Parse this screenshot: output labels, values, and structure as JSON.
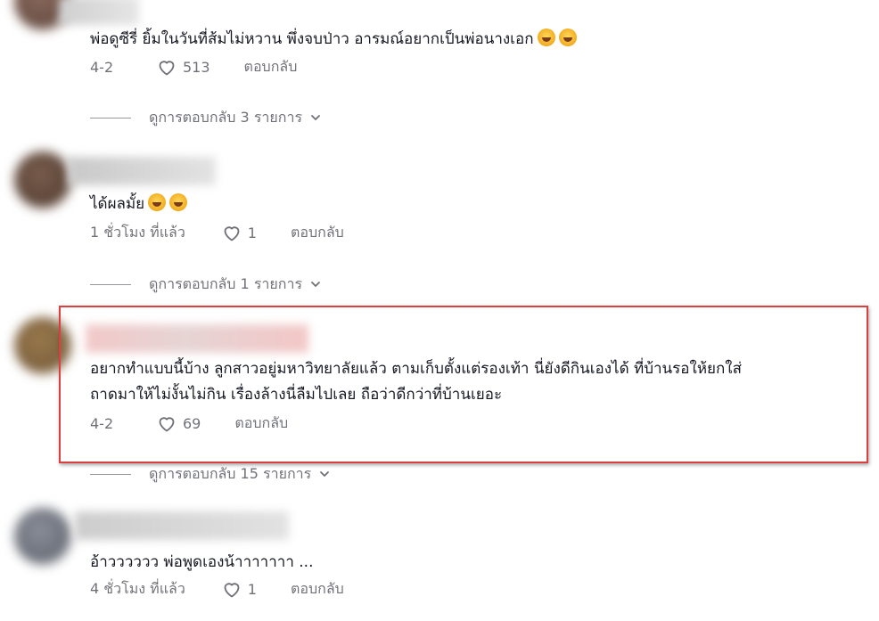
{
  "comments": [
    {
      "text": "พ่อดูซีรี่ ยิ้มในวันที่ส้มไม่หวาน พึ่งจบป่าว อารมณ์อยากเป็นพ่อนางเอก",
      "emoji": [
        "rolling-on-floor-laughing",
        "rolling-on-floor-laughing"
      ],
      "date": "4-2",
      "likes": "513",
      "reply_label": "ตอบกลับ",
      "view_replies": "ดูการตอบกลับ 3 รายการ"
    },
    {
      "text": "ได้ผลมั้ย",
      "emoji": [
        "rolling-on-floor-laughing",
        "rolling-on-floor-laughing"
      ],
      "date": "1 ชั่วโมง ที่แล้ว",
      "likes": "1",
      "reply_label": "ตอบกลับ",
      "view_replies": "ดูการตอบกลับ 1 รายการ"
    },
    {
      "text_line1": "อยากทำแบบนี้บ้าง ลูกสาวอยู่มหาวิทยาลัยแล้ว ตามเก็บตั้งแต่รองเท้า นี่ยังดีกินเองได้ ที่บ้านรอให้ยกใส่",
      "text_line2": "ถาดมาให้ไม่งั้นไม่กิน เรื่องล้างนี่ลืมไปเลย ถือว่าดีกว่าที่บ้านเยอะ",
      "date": "4-2",
      "likes": "69",
      "reply_label": "ตอบกลับ",
      "view_replies": "ดูการตอบกลับ 15 รายการ",
      "highlight_color": "#d9403f"
    },
    {
      "text": "อ้าวววววว พ่อพูดเองน้าาาาาาา ...",
      "date": "4 ชั่วโมง ที่แล้ว",
      "likes": "1",
      "reply_label": "ตอบกลับ"
    }
  ],
  "icons": {
    "like": "heart-outline-icon",
    "expand": "chevron-down-icon"
  }
}
